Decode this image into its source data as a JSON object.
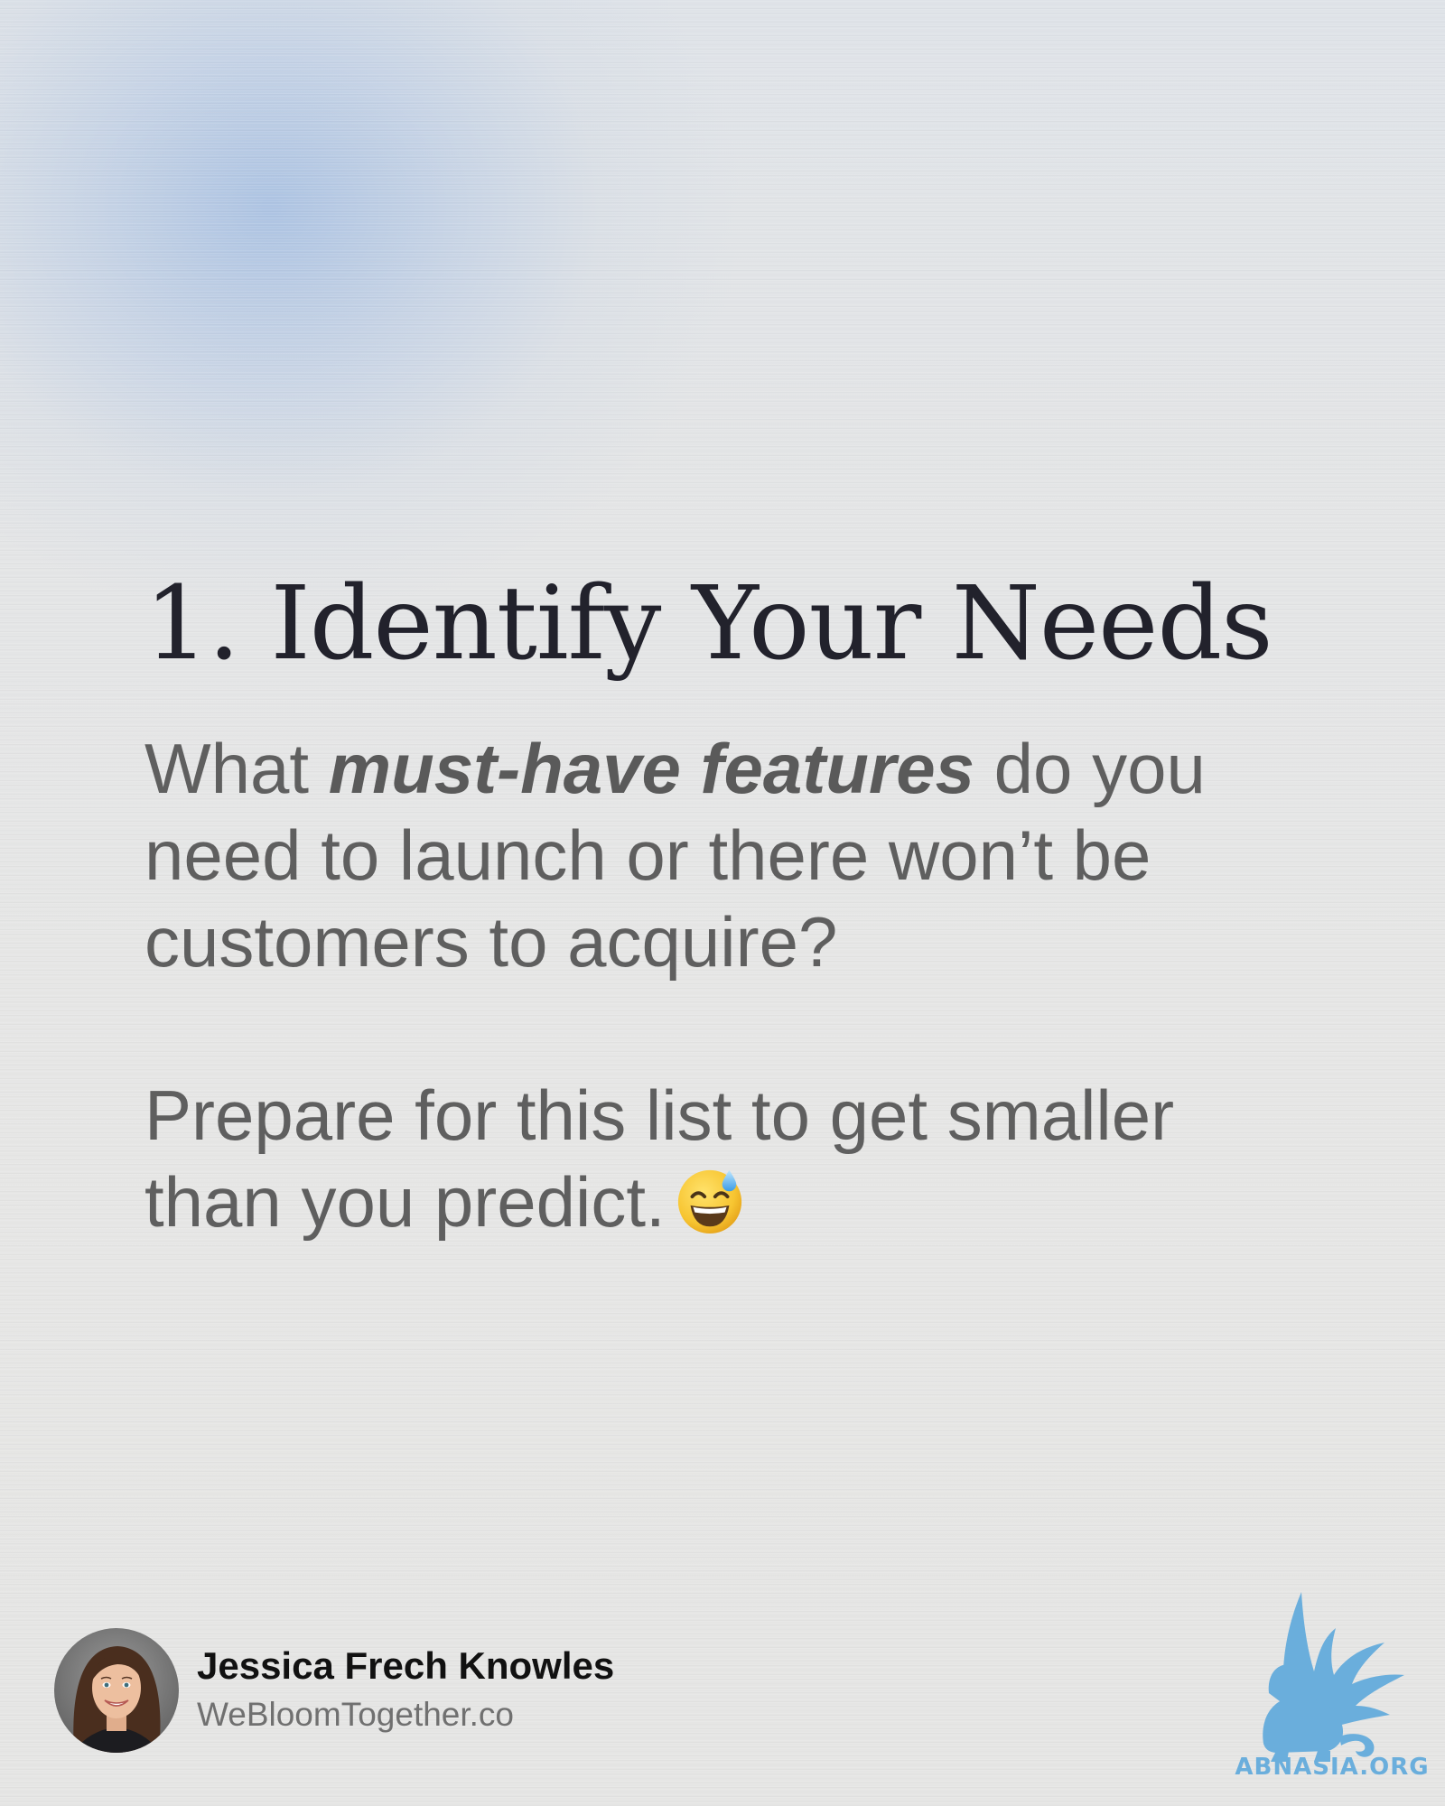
{
  "slide": {
    "heading": "1. Identify Your Needs",
    "paragraph1": {
      "before": "What ",
      "emphasis": "must-have features",
      "after": " do you need to launch or there won’t be customers to acquire?"
    },
    "paragraph2": {
      "text": "Prepare for this list to get smaller than you predict.",
      "emoji_icon": "grinning-face-with-sweat-emoji"
    }
  },
  "author": {
    "name": "Jessica Frech Knowles",
    "website": "WeBloomTogether.co",
    "avatar_icon": "author-portrait-photo"
  },
  "watermark": {
    "logo_icon": "griffin-logo",
    "text": "ABNASIA.ORG",
    "color": "#6aaedc"
  },
  "colors": {
    "background": "#e6e6e5",
    "accent_glow": "#a4bee2",
    "heading": "#22222c",
    "body_text": "#5f5f5f"
  }
}
